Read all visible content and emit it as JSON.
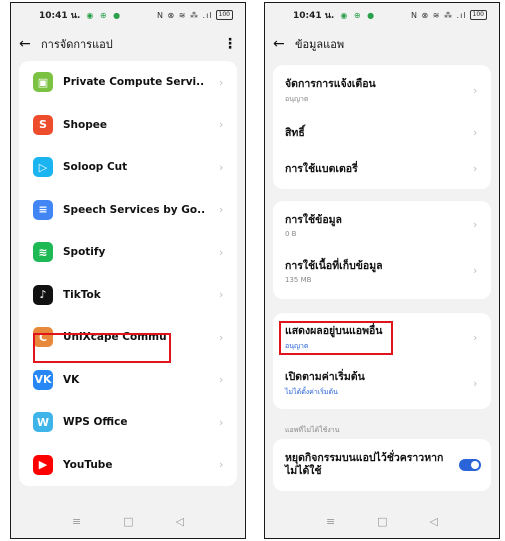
{
  "status": {
    "time": "10:41 น.",
    "sys_icons": "N ⊗ ≋ ⁂ .ıl",
    "battery": "100"
  },
  "left": {
    "title": "การจัดการแอป",
    "apps": [
      {
        "name": "Private Compute Servi..",
        "icon": "private-compute-icon",
        "color": "#7cc242",
        "glyph": "▣"
      },
      {
        "name": "Shopee",
        "icon": "shopee-icon",
        "color": "#ee4d2d",
        "glyph": "S"
      },
      {
        "name": "Soloop Cut",
        "icon": "soloop-icon",
        "color": "#1ab4f0",
        "glyph": "▷"
      },
      {
        "name": "Speech Services by Go..",
        "icon": "speech-services-icon",
        "color": "#4285f4",
        "glyph": "≡"
      },
      {
        "name": "Spotify",
        "icon": "spotify-icon",
        "color": "#1db954",
        "glyph": "≋"
      },
      {
        "name": "TikTok",
        "icon": "tiktok-icon",
        "color": "#111111",
        "glyph": "♪"
      },
      {
        "name": "UniXcape Commu",
        "icon": "unixcape-icon",
        "color": "#e8883a",
        "glyph": "C"
      },
      {
        "name": "VK",
        "icon": "vk-icon",
        "color": "#2787f5",
        "glyph": "VK"
      },
      {
        "name": "WPS Office",
        "icon": "wps-office-icon",
        "color": "#3fb4e8",
        "glyph": "W"
      },
      {
        "name": "YouTube",
        "icon": "youtube-icon",
        "color": "#ff0000",
        "glyph": "▶"
      }
    ]
  },
  "right": {
    "title": "ข้อมูลแอพ",
    "card1": [
      {
        "main": "จัดการการแจ้งเตือน",
        "sub": "อนุญาต"
      },
      {
        "main": "สิทธิ์",
        "sub": ""
      },
      {
        "main": "การใช้แบตเตอรี่",
        "sub": ""
      }
    ],
    "card2": [
      {
        "main": "การใช้ข้อมูล",
        "sub": "0 B"
      },
      {
        "main": "การใช้เนื้อที่เก็บข้อมูล",
        "sub": "135 MB"
      }
    ],
    "card3": [
      {
        "main": "แสดงผลอยู่บนแอพอื่น",
        "sub": "อนุญาต"
      },
      {
        "main": "เปิดตามค่าเริ่มต้น",
        "sub": "ไม่ได้ตั้งค่าเริ่มต้น"
      }
    ],
    "section_label": "แอพที่ไม่ได้ใช้งาน",
    "pause_label": "หยุดกิจกรรมบนแอปไว้ชั่วคราวหากไม่ได้ใช้"
  },
  "nav": {
    "menu": "≡",
    "home": "□",
    "back": "◁"
  }
}
